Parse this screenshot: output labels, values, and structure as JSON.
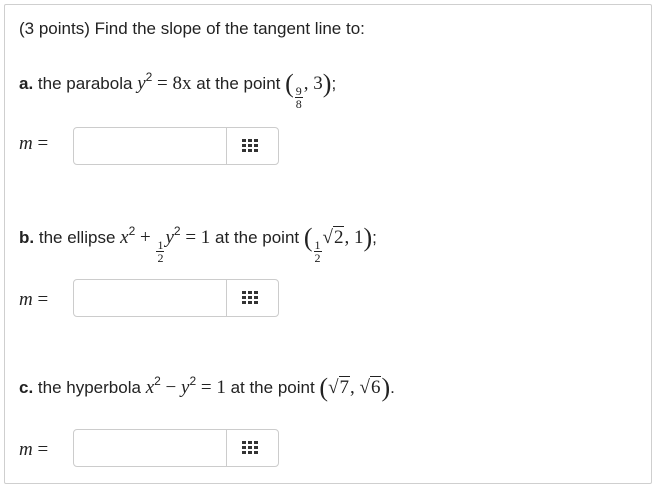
{
  "question": {
    "header": "(3 points) Find the slope of the tangent line to:",
    "a": {
      "label": "a.",
      "text1": "the parabola",
      "eq_lhs": "y",
      "eq_rhs": "= 8x",
      "text2": "at the point",
      "point_num": "9",
      "point_den": "8",
      "point_y": "3",
      "end": ";"
    },
    "b": {
      "label": "b.",
      "text1": "the ellipse",
      "eq": "x",
      "plus": "+",
      "frac_num": "1",
      "frac_den": "2",
      "y": "y",
      "rhs": "= 1",
      "text2": "at the point",
      "pt_num": "1",
      "pt_den": "2",
      "pt_rad": "2",
      "pt_y": "1",
      "end": ";"
    },
    "c": {
      "label": "c.",
      "text1": "the hyperbola",
      "x": "x",
      "minus": "−",
      "y": "y",
      "rhs": "= 1",
      "text2": "at the point",
      "rad1": "7",
      "rad2": "6",
      "end": "."
    }
  },
  "answers": {
    "m_label": "m",
    "equals": "=",
    "a_value": "",
    "b_value": "",
    "c_value": ""
  },
  "icons": {
    "keyboard": "keypad-icon"
  }
}
